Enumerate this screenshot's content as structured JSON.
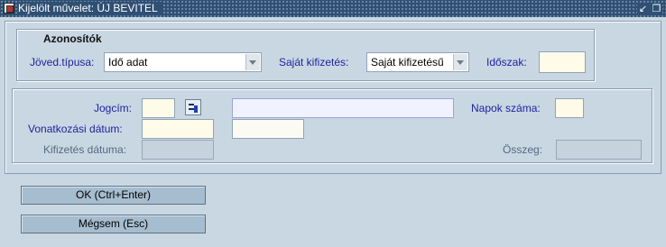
{
  "window": {
    "title": "Kijelölt művelet: ÚJ BEVITEL"
  },
  "section_azonositok": {
    "title": "Azonosítók",
    "joved_label": "Jöved.típusa:",
    "joved_value": "Idő adat",
    "sajat_label": "Saját kifizetés:",
    "sajat_value": "Saját kifizetésű",
    "idoszak_label": "Időszak:",
    "idoszak_value": ""
  },
  "section_details": {
    "jogcim_label": "Jogcím:",
    "jogcim_value": "",
    "jogcim_desc_value": "",
    "napok_label": "Napok száma:",
    "napok_value": "",
    "vonatkozasi_label": "Vonatkozási dátum:",
    "vonatkozasi_from": "",
    "vonatkozasi_to": "",
    "kifizetes_label": "Kifizetés dátuma:",
    "kifizetes_value": "",
    "osszeg_label": "Összeg:",
    "osszeg_value": ""
  },
  "buttons": {
    "ok_label": "OK (Ctrl+Enter)",
    "cancel_label": "Mégsem (Esc)"
  },
  "icons": {
    "window_icon": "app-window-icon",
    "lov": "list-of-values-icon",
    "minimize": "minimize-icon",
    "restore": "restore-icon"
  },
  "colors": {
    "background": "#c9d7e2",
    "label_blue": "#2222a0",
    "input_yellow": "#fffbe9",
    "button": "#a6bccf",
    "title_bar": "#2f4f73"
  }
}
